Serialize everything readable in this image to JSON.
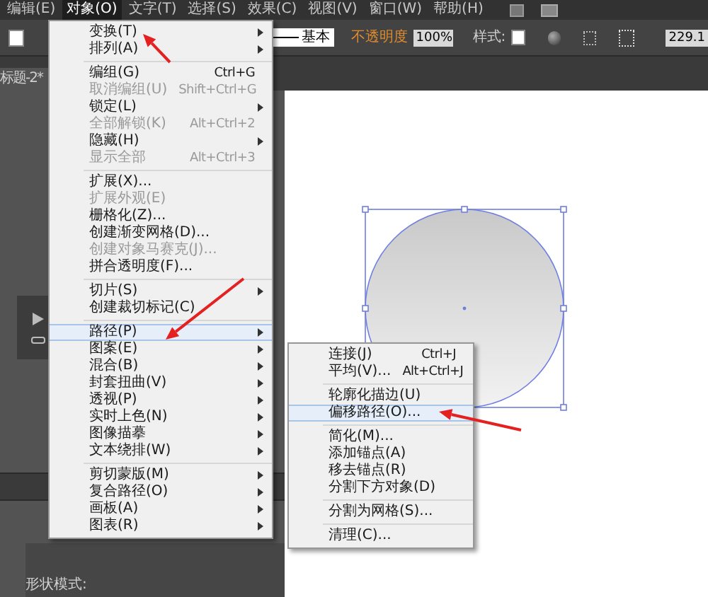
{
  "menu_bar": [
    {
      "label": "编辑(E)",
      "selected": false
    },
    {
      "label": "对象(O)",
      "selected": true
    },
    {
      "label": "文字(T)",
      "selected": false
    },
    {
      "label": "选择(S)",
      "selected": false
    },
    {
      "label": "效果(C)",
      "selected": false
    },
    {
      "label": "视图(V)",
      "selected": false
    },
    {
      "label": "窗口(W)",
      "selected": false
    },
    {
      "label": "帮助(H)",
      "selected": false
    }
  ],
  "control_bar": {
    "stroke_profile": "基本",
    "opacity_label": "不透明度",
    "opacity_value": "100%",
    "style_label": "样式:",
    "x_value": "229.1"
  },
  "document_tab": {
    "title": "标题-2*"
  },
  "panel": {
    "label": "形状模式:"
  },
  "object_menu": [
    {
      "kind": "item",
      "label": "变换(T)",
      "submenu": true,
      "disabled": false,
      "selected": false
    },
    {
      "kind": "item",
      "label": "排列(A)",
      "submenu": true,
      "disabled": false,
      "selected": false
    },
    {
      "kind": "separator"
    },
    {
      "kind": "item",
      "label": "编组(G)",
      "shortcut": "Ctrl+G",
      "submenu": false,
      "disabled": false,
      "selected": false
    },
    {
      "kind": "item",
      "label": "取消编组(U)",
      "shortcut": "Shift+Ctrl+G",
      "submenu": false,
      "disabled": true,
      "selected": false
    },
    {
      "kind": "item",
      "label": "锁定(L)",
      "submenu": true,
      "disabled": false,
      "selected": false
    },
    {
      "kind": "item",
      "label": "全部解锁(K)",
      "shortcut": "Alt+Ctrl+2",
      "submenu": false,
      "disabled": true,
      "selected": false
    },
    {
      "kind": "item",
      "label": "隐藏(H)",
      "submenu": true,
      "disabled": false,
      "selected": false
    },
    {
      "kind": "item",
      "label": "显示全部",
      "shortcut": "Alt+Ctrl+3",
      "submenu": false,
      "disabled": true,
      "selected": false
    },
    {
      "kind": "separator"
    },
    {
      "kind": "item",
      "label": "扩展(X)...",
      "submenu": false,
      "disabled": false,
      "selected": false
    },
    {
      "kind": "item",
      "label": "扩展外观(E)",
      "submenu": false,
      "disabled": true,
      "selected": false
    },
    {
      "kind": "item",
      "label": "栅格化(Z)...",
      "submenu": false,
      "disabled": false,
      "selected": false
    },
    {
      "kind": "item",
      "label": "创建渐变网格(D)...",
      "submenu": false,
      "disabled": false,
      "selected": false
    },
    {
      "kind": "item",
      "label": "创建对象马赛克(J)...",
      "submenu": false,
      "disabled": true,
      "selected": false
    },
    {
      "kind": "item",
      "label": "拼合透明度(F)...",
      "submenu": false,
      "disabled": false,
      "selected": false
    },
    {
      "kind": "separator"
    },
    {
      "kind": "item",
      "label": "切片(S)",
      "submenu": true,
      "disabled": false,
      "selected": false
    },
    {
      "kind": "item",
      "label": "创建裁切标记(C)",
      "submenu": false,
      "disabled": false,
      "selected": false
    },
    {
      "kind": "separator"
    },
    {
      "kind": "item",
      "label": "路径(P)",
      "submenu": true,
      "disabled": false,
      "selected": true
    },
    {
      "kind": "item",
      "label": "图案(E)",
      "submenu": true,
      "disabled": false,
      "selected": false
    },
    {
      "kind": "item",
      "label": "混合(B)",
      "submenu": true,
      "disabled": false,
      "selected": false
    },
    {
      "kind": "item",
      "label": "封套扭曲(V)",
      "submenu": true,
      "disabled": false,
      "selected": false
    },
    {
      "kind": "item",
      "label": "透视(P)",
      "submenu": true,
      "disabled": false,
      "selected": false
    },
    {
      "kind": "item",
      "label": "实时上色(N)",
      "submenu": true,
      "disabled": false,
      "selected": false
    },
    {
      "kind": "item",
      "label": "图像描摹",
      "submenu": true,
      "disabled": false,
      "selected": false
    },
    {
      "kind": "item",
      "label": "文本绕排(W)",
      "submenu": true,
      "disabled": false,
      "selected": false
    },
    {
      "kind": "separator"
    },
    {
      "kind": "item",
      "label": "剪切蒙版(M)",
      "submenu": true,
      "disabled": false,
      "selected": false
    },
    {
      "kind": "item",
      "label": "复合路径(O)",
      "submenu": true,
      "disabled": false,
      "selected": false
    },
    {
      "kind": "item",
      "label": "画板(A)",
      "submenu": true,
      "disabled": false,
      "selected": false
    },
    {
      "kind": "item",
      "label": "图表(R)",
      "submenu": true,
      "disabled": false,
      "selected": false
    }
  ],
  "path_submenu": [
    {
      "kind": "item",
      "label": "连接(J)",
      "shortcut": "Ctrl+J",
      "submenu": false,
      "disabled": false,
      "selected": false
    },
    {
      "kind": "item",
      "label": "平均(V)...",
      "shortcut": "Alt+Ctrl+J",
      "submenu": false,
      "disabled": false,
      "selected": false
    },
    {
      "kind": "separator"
    },
    {
      "kind": "item",
      "label": "轮廓化描边(U)",
      "submenu": false,
      "disabled": false,
      "selected": false
    },
    {
      "kind": "item",
      "label": "偏移路径(O)...",
      "submenu": false,
      "disabled": false,
      "selected": true
    },
    {
      "kind": "separator"
    },
    {
      "kind": "item",
      "label": "简化(M)...",
      "submenu": false,
      "disabled": false,
      "selected": false
    },
    {
      "kind": "item",
      "label": "添加锚点(A)",
      "submenu": false,
      "disabled": false,
      "selected": false
    },
    {
      "kind": "item",
      "label": "移去锚点(R)",
      "submenu": false,
      "disabled": false,
      "selected": false
    },
    {
      "kind": "item",
      "label": "分割下方对象(D)",
      "submenu": false,
      "disabled": false,
      "selected": false
    },
    {
      "kind": "separator"
    },
    {
      "kind": "item",
      "label": "分割为网格(S)...",
      "submenu": false,
      "disabled": false,
      "selected": false
    },
    {
      "kind": "separator"
    },
    {
      "kind": "item",
      "label": "清理(C)...",
      "submenu": false,
      "disabled": false,
      "selected": false
    }
  ]
}
